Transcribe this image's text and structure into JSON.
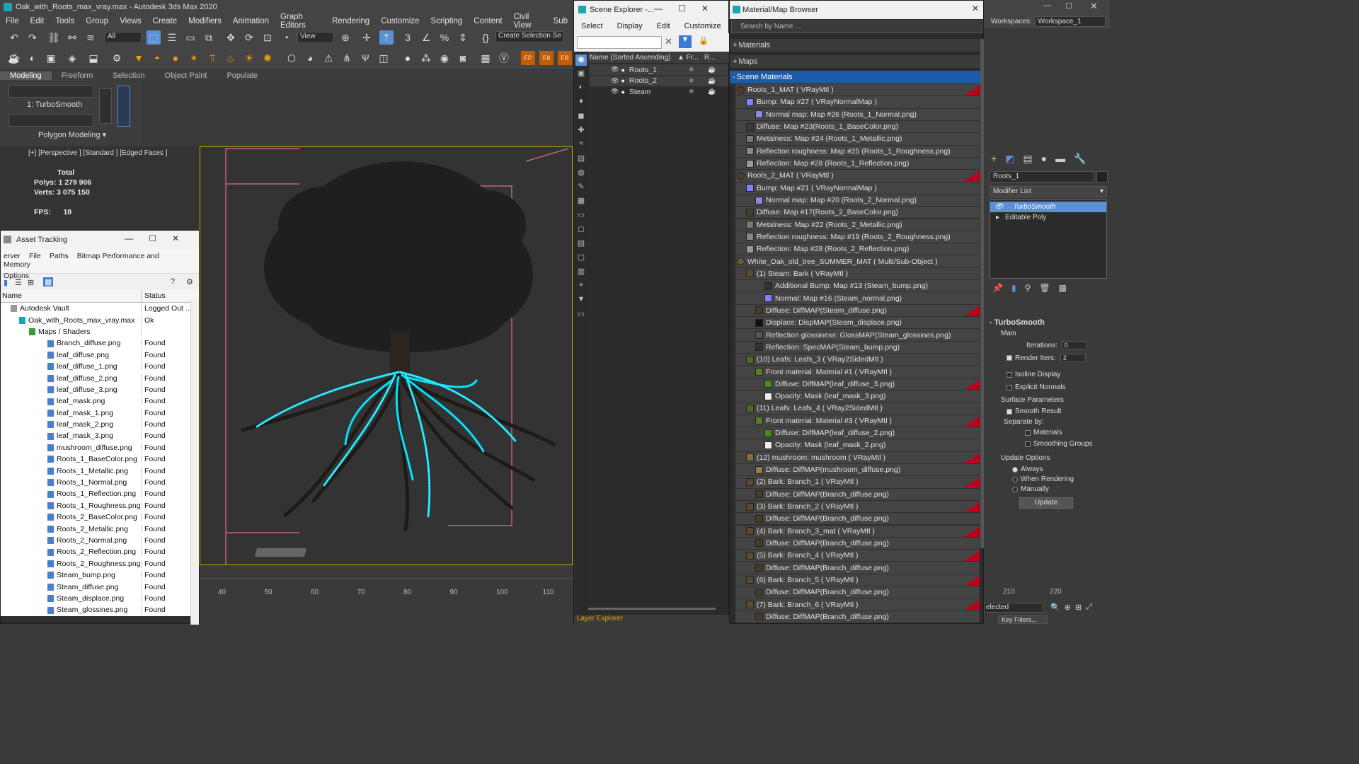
{
  "app": {
    "title": "Oak_with_Roots_max_vray.max - Autodesk 3ds Max 2020"
  },
  "menu": [
    "File",
    "Edit",
    "Tools",
    "Group",
    "Views",
    "Create",
    "Modifiers",
    "Animation",
    "Graph Editors",
    "Rendering",
    "Customize",
    "Scripting",
    "Content",
    "Civil View",
    "Sub"
  ],
  "toolbar": {
    "filter": "All",
    "view": "View",
    "selection_set": "Create Selection Se"
  },
  "ribbon": {
    "tabs": [
      "Modeling",
      "Freeform",
      "Selection",
      "Object Paint",
      "Populate"
    ],
    "modifier": "1: TurboSmooth",
    "panel": "Polygon Modeling"
  },
  "viewport": {
    "label": "[+] [Perspective ] [Standard ] [Edged Faces ]",
    "stats_total": "Total",
    "polys_label": "Polys:",
    "polys": "1 279 906",
    "verts_label": "Verts:",
    "verts": "3 075 150",
    "fps_label": "FPS:",
    "fps": "18"
  },
  "timeline": {
    "ticks": [
      "40",
      "50",
      "60",
      "70",
      "80",
      "90",
      "100",
      "110"
    ],
    "ticks_right": [
      "210",
      "220"
    ]
  },
  "asset_tracking": {
    "title": "Asset Tracking",
    "menu": [
      "erver",
      "File",
      "Paths",
      "Bitmap Performance and Memory"
    ],
    "menu2": "Options",
    "col_name": "Name",
    "col_status": "Status",
    "vault": {
      "name": "Autodesk Vault",
      "status": "Logged Out ..."
    },
    "file": {
      "name": "Oak_with_Roots_max_vray.max",
      "status": "Ok"
    },
    "group": "Maps / Shaders",
    "rows": [
      {
        "name": "Branch_diffuse.png",
        "status": "Found"
      },
      {
        "name": "leaf_diffuse.png",
        "status": "Found"
      },
      {
        "name": "leaf_diffuse_1.png",
        "status": "Found"
      },
      {
        "name": "leaf_diffuse_2.png",
        "status": "Found"
      },
      {
        "name": "leaf_diffuse_3.png",
        "status": "Found"
      },
      {
        "name": "leaf_mask.png",
        "status": "Found"
      },
      {
        "name": "leaf_mask_1.png",
        "status": "Found"
      },
      {
        "name": "leaf_mask_2.png",
        "status": "Found"
      },
      {
        "name": "leaf_mask_3.png",
        "status": "Found"
      },
      {
        "name": "mushroom_diffuse.png",
        "status": "Found"
      },
      {
        "name": "Roots_1_BaseColor.png",
        "status": "Found"
      },
      {
        "name": "Roots_1_Metallic.png",
        "status": "Found"
      },
      {
        "name": "Roots_1_Normal.png",
        "status": "Found"
      },
      {
        "name": "Roots_1_Reflection.png",
        "status": "Found"
      },
      {
        "name": "Roots_1_Roughness.png",
        "status": "Found"
      },
      {
        "name": "Roots_2_BaseColor.png",
        "status": "Found"
      },
      {
        "name": "Roots_2_Metallic.png",
        "status": "Found"
      },
      {
        "name": "Roots_2_Normal.png",
        "status": "Found"
      },
      {
        "name": "Roots_2_Reflection.png",
        "status": "Found"
      },
      {
        "name": "Roots_2_Roughness.png",
        "status": "Found"
      },
      {
        "name": "Steam_bump.png",
        "status": "Found"
      },
      {
        "name": "Steam_diffuse.png",
        "status": "Found"
      },
      {
        "name": "Steam_displace.png",
        "status": "Found"
      },
      {
        "name": "Steam_glossines.png",
        "status": "Found"
      }
    ]
  },
  "scene_explorer": {
    "title": "Scene Explorer -...",
    "menu": [
      "Select",
      "Display",
      "Edit",
      "Customize"
    ],
    "col_name": "Name (Sorted Ascending)",
    "col_fr": "▲ Fr...",
    "col_r": "R...",
    "items": [
      "Roots_1",
      "Roots_2",
      "Steam"
    ],
    "footer": "Layer Explorer"
  },
  "material_browser": {
    "title": "Material/Map Browser",
    "search_placeholder": "Search by Name ...",
    "sections": [
      "Materials",
      "Maps",
      "Scene Materials"
    ],
    "rows": [
      {
        "indent": 0,
        "text": "Roots_1_MAT  ( VRayMtl )",
        "swatch": "#5a3a22",
        "red": true
      },
      {
        "indent": 1,
        "text": "Bump: Map #27  ( VRayNormalMap )",
        "swatch": "#8080ff",
        "red": false
      },
      {
        "indent": 2,
        "text": "Normal map: Map #26 (Roots_1_Normal.png)",
        "swatch": "#8a8ae0",
        "red": false
      },
      {
        "indent": 1,
        "text": "Diffuse: Map #23(Roots_1_BaseColor.png)",
        "swatch": "#4a3a2a",
        "red": false
      },
      {
        "indent": 1,
        "text": "Metalness: Map #24 (Roots_1_Metallic.png)",
        "swatch": "#777",
        "red": false
      },
      {
        "indent": 1,
        "text": "Reflection roughness: Map #25 (Roots_1_Roughness.png)",
        "swatch": "#888",
        "red": false
      },
      {
        "indent": 1,
        "text": "Reflection: Map #28 (Roots_1_Reflection.png)",
        "swatch": "#999",
        "red": false
      },
      {
        "indent": 0,
        "text": "Roots_2_MAT  ( VRayMtl )",
        "swatch": "#5a3a22",
        "red": true
      },
      {
        "indent": 1,
        "text": "Bump: Map #21  ( VRayNormalMap )",
        "swatch": "#8080ff",
        "red": false
      },
      {
        "indent": 2,
        "text": "Normal map: Map #20 (Roots_2_Normal.png)",
        "swatch": "#8a8ae0",
        "red": false
      },
      {
        "indent": 1,
        "text": "Diffuse: Map #17(Roots_2_BaseColor.png)",
        "swatch": "#4a3a2a",
        "red": false
      },
      {
        "indent": 1,
        "text": "Metalness: Map #22 (Roots_2_Metallic.png)",
        "swatch": "#777",
        "red": false
      },
      {
        "indent": 1,
        "text": "Reflection roughness: Map #19 (Roots_2_Roughness.png)",
        "swatch": "#888",
        "red": false
      },
      {
        "indent": 1,
        "text": "Reflection: Map #28 (Roots_2_Reflection.png)",
        "swatch": "#999",
        "red": false
      },
      {
        "indent": 0,
        "text": "White_Oak_old_tree_SUMMER_MAT  ( Multi/Sub-Object )",
        "swatch": "#6a5a30",
        "red": false
      },
      {
        "indent": 1,
        "text": "(1) Steam: Bark  ( VRayMtl )",
        "swatch": "#5a4a35",
        "red": false
      },
      {
        "indent": 3,
        "text": "Additional Bump: Map #13 (Steam_bump.png)",
        "swatch": "#333",
        "red": false
      },
      {
        "indent": 3,
        "text": "Normal: Map #16 (Steam_normal.png)",
        "swatch": "#8080ff",
        "red": false
      },
      {
        "indent": 2,
        "text": "Diffuse: DiffMAP(Steam_diffuse.png)",
        "swatch": "#4a3a2a",
        "red": true
      },
      {
        "indent": 2,
        "text": "Displace: DispMAP(Steam_displace.png)",
        "swatch": "#111",
        "red": false
      },
      {
        "indent": 2,
        "text": "Reflection glossiness: GlossMAP(Steam_glossines.png)",
        "swatch": "#555",
        "red": false
      },
      {
        "indent": 2,
        "text": "Reflection: SpecMAP(Steam_bump.png)",
        "swatch": "#333",
        "red": false
      },
      {
        "indent": 1,
        "text": "(10) Leafs: Leafs_3  ( VRay2SidedMtl )",
        "swatch": "#4a6a2a",
        "red": false
      },
      {
        "indent": 2,
        "text": "Front material: Material #1  ( VRayMtl )",
        "swatch": "#5a7a2a",
        "red": false
      },
      {
        "indent": 3,
        "text": "Diffuse: DiffMAP(leaf_diffuse_3.png)",
        "swatch": "#4a8a1a",
        "red": true
      },
      {
        "indent": 3,
        "text": "Opacity: Mask (leaf_mask_3.png)",
        "swatch": "#eee",
        "red": false
      },
      {
        "indent": 1,
        "text": "(11) Leafs: Leafs_4  ( VRay2SidedMtl )",
        "swatch": "#4a6a2a",
        "red": false
      },
      {
        "indent": 2,
        "text": "Front material: Material #3  ( VRayMtl )",
        "swatch": "#5a7a2a",
        "red": true
      },
      {
        "indent": 3,
        "text": "Diffuse: DiffMAP(leaf_diffuse_2.png)",
        "swatch": "#4a8a1a",
        "red": false
      },
      {
        "indent": 3,
        "text": "Opacity: Mask (leaf_mask_2.png)",
        "swatch": "#eee",
        "red": false
      },
      {
        "indent": 1,
        "text": "(12) mushroom: mushroom  ( VRayMtl )",
        "swatch": "#8a6a3a",
        "red": true
      },
      {
        "indent": 2,
        "text": "Diffuse: DiffMAP(mushroom_diffuse.png)",
        "swatch": "#9a7a4a",
        "red": false
      },
      {
        "indent": 1,
        "text": "(2) Bark: Branch_1  ( VRayMtl )",
        "swatch": "#5a4a35",
        "red": true
      },
      {
        "indent": 2,
        "text": "Diffuse: DiffMAP(Branch_diffuse.png)",
        "swatch": "#4a3a2a",
        "red": false
      },
      {
        "indent": 1,
        "text": "(3) Bark: Branch_2  ( VRayMtl )",
        "swatch": "#5a4a35",
        "red": true
      },
      {
        "indent": 2,
        "text": "Diffuse: DiffMAP(Branch_diffuse.png)",
        "swatch": "#4a3a2a",
        "red": false
      },
      {
        "indent": 1,
        "text": "(4) Bark: Branch_3_mat  ( VRayMtl )",
        "swatch": "#5a4a35",
        "red": true
      },
      {
        "indent": 2,
        "text": "Diffuse: DiffMAP(Branch_diffuse.png)",
        "swatch": "#4a3a2a",
        "red": false
      },
      {
        "indent": 1,
        "text": "(5) Bark: Branch_4  ( VRayMtl )",
        "swatch": "#5a4a35",
        "red": true
      },
      {
        "indent": 2,
        "text": "Diffuse: DiffMAP(Branch_diffuse.png)",
        "swatch": "#4a3a2a",
        "red": false
      },
      {
        "indent": 1,
        "text": "(6) Bark: Branch_5  ( VRayMtl )",
        "swatch": "#5a4a35",
        "red": true
      },
      {
        "indent": 2,
        "text": "Diffuse: DiffMAP(Branch_diffuse.png)",
        "swatch": "#4a3a2a",
        "red": false
      },
      {
        "indent": 1,
        "text": "(7) Bark: Branch_6  ( VRayMtl )",
        "swatch": "#5a4a35",
        "red": true
      },
      {
        "indent": 2,
        "text": "Diffuse: DiffMAP(Branch_diffuse.png)",
        "swatch": "#4a3a2a",
        "red": false
      }
    ]
  },
  "command_panel": {
    "workspaces_label": "Workspaces:",
    "workspace": "Workspace_1",
    "object_name": "Roots_1",
    "modifier_list": "Modifier List",
    "stack": [
      "TurboSmooth",
      "Editable Poly"
    ],
    "rollout": "TurboSmooth",
    "main": "Main",
    "iterations_label": "Iterations:",
    "iterations": "0",
    "render_iters_label": "Render Iters:",
    "render_iters": "2",
    "isoline": "Isoline Display",
    "explicit": "Explicit Normals",
    "surface": "Surface Parameters",
    "smooth_result": "Smooth Result",
    "separate": "Separate by:",
    "materials": "Materials",
    "smoothing_groups": "Smoothing Groups",
    "update_options": "Update Options",
    "always": "Always",
    "when_rendering": "When Rendering",
    "manually": "Manually",
    "update_button": "Update",
    "selected": "elected",
    "key_filters": "Key Filters..."
  },
  "colors": {
    "accent": "#3c78d8",
    "selection": "#00e5ff",
    "warn_red": "#c0001a",
    "viewport_border": "#c9a600"
  }
}
